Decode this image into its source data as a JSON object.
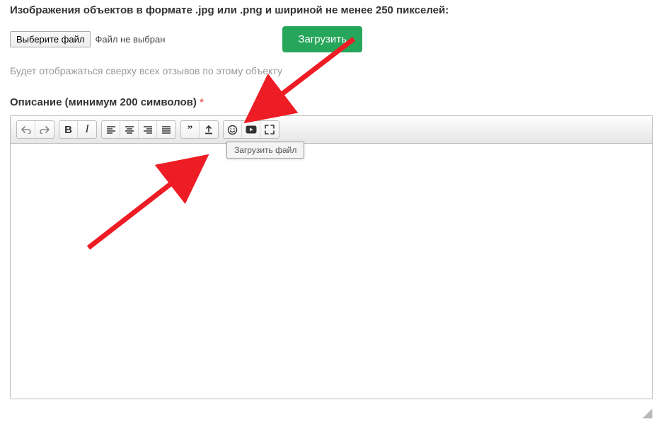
{
  "upload": {
    "heading": "Изображения объектов в формате .jpg или .png и шириной не менее 250 пикселей:",
    "choose_button": "Выберите файл",
    "no_file": "Файл не выбран",
    "submit_button": "Загрузить",
    "hint": "Будет отображаться сверху всех отзывов по этому объекту"
  },
  "description": {
    "label": "Описание (минимум 200 символов)",
    "required": "*"
  },
  "tooltip": {
    "upload_file": "Загрузить файл"
  },
  "toolbar_icons": {
    "undo": "undo",
    "redo": "redo",
    "bold": "B",
    "italic": "I",
    "align_left": "align-left",
    "align_center": "align-center",
    "align_right": "align-right",
    "align_justify": "align-justify",
    "quote": "”",
    "upload": "upload",
    "emoji": "emoji",
    "youtube": "youtube",
    "fullscreen": "fullscreen"
  },
  "colors": {
    "accent_green": "#26a65b",
    "arrow_red": "#ee1c25"
  }
}
